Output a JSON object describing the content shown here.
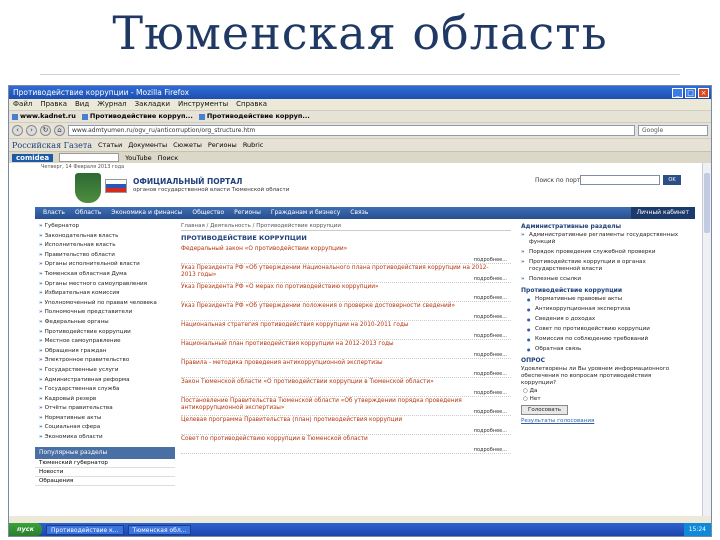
{
  "slide": {
    "title": "Тюменская область"
  },
  "browser": {
    "window_title": "Противодействие коррупции - Mozilla Firefox",
    "menu": [
      "Файл",
      "Правка",
      "Вид",
      "Журнал",
      "Закладки",
      "Инструменты",
      "Справка"
    ],
    "bookmarks": [
      "www.kadnet.ru",
      "Противодействие корруп...",
      "Противодействие корруп..."
    ],
    "url": "www.admtyumen.ru/ogv_ru/anticorruption/org_structure.htm",
    "search_placeholder": "Google",
    "toolbar2": [
      "Российская Газета",
      "Статьи",
      "Документы",
      "Сюжеты",
      "Регионы",
      "Rubric"
    ],
    "toolbar3_logo": "comidea",
    "toolbar3_field": "YouTube",
    "toolbar3_btn": "Поиск"
  },
  "site": {
    "top_line": "Четверг, 14 Февраля 2013 года",
    "name": "ОФИЦИАЛЬНЫЙ ПОРТАЛ",
    "subtitle": "органов государственной власти Тюменской области",
    "search_label": "Поиск по порталу",
    "search_btn": "OK",
    "nav": [
      "Власть",
      "Область",
      "Экономика и финансы",
      "Общество",
      "Регионы",
      "Гражданам и бизнесу",
      "Связь"
    ],
    "cabinet": "Личный кабинет",
    "breadcrumb": "Главная / Деятельность / Противодействие коррупции",
    "section_title": "ПРОТИВОДЕЙСТВИЕ КОРРУПЦИИ",
    "left_links": [
      "Губернатор",
      "Законодательная власть",
      "Исполнительная власть",
      "Правительство области",
      "Органы исполнительной власти",
      "Тюменская областная Дума",
      "Органы местного самоуправления",
      "Избирательная комиссия",
      "Уполномоченный по правам человека",
      "Полномочные представители",
      "Федеральные органы",
      "Противодействие коррупции",
      "Местное самоуправление",
      "Обращения граждан",
      "Электронное правительство",
      "Государственные услуги",
      "Административная реформа",
      "Государственная служба",
      "Кадровый резерв",
      "Отчёты правительства",
      "Нормативные акты",
      "Социальная сфера",
      "Экономика области"
    ],
    "left_box_title": "Популярные разделы",
    "left_box_items": [
      "Тюменский губернатор",
      "Новости",
      "Обращения"
    ],
    "news": [
      {
        "title": "Федеральный закон «О противодействии коррупции»",
        "more": "подробнее..."
      },
      {
        "title": "Указ Президента РФ «Об утверждении Национального плана противодействия коррупции на 2012-2013 годы»",
        "more": "подробнее..."
      },
      {
        "title": "Указ Президента РФ «О мерах по противодействию коррупции»",
        "more": "подробнее..."
      },
      {
        "title": "Указ Президента РФ «Об утверждении положения о проверке достоверности сведений»",
        "more": "подробнее..."
      },
      {
        "title": "Национальная стратегия противодействия коррупции на 2010-2011 годы",
        "more": "подробнее..."
      },
      {
        "title": "Национальный план противодействия коррупции на 2012-2013 годы",
        "more": "подробнее..."
      },
      {
        "title": "Правила - методика проведения антикоррупционной экспертизы",
        "more": "подробнее..."
      },
      {
        "title": "Закон Тюменской области «О противодействии коррупции в Тюменской области»",
        "more": "подробнее..."
      },
      {
        "title": "Постановление Правительства Тюменской области «Об утверждении порядка проведения антикоррупционной экспертизы»",
        "more": "подробнее..."
      },
      {
        "title": "Целевая программа Правительства (план) противодействия коррупции",
        "more": "подробнее..."
      },
      {
        "title": "Совет по противодействию коррупции в Тюменской области",
        "more": "подробнее..."
      }
    ],
    "right_head1": "Административные разделы",
    "right_items": [
      "Административные регламенты государственных функций",
      "Порядок проведения служебной проверки",
      "Противодействие коррупции в органах государственной власти",
      "Полезные ссылки"
    ],
    "right_head2": "Противодействие коррупции",
    "right_sub": [
      "Нормативные правовые акты",
      "Антикоррупционная экспертиза",
      "Сведения о доходах",
      "Совет по противодействию коррупции",
      "Комиссия по соблюдению требований",
      "Обратная связь"
    ],
    "poll_head": "ОПРОС",
    "poll_question": "Удовлетворены ли Вы уровнем информационного обеспечения по вопросам противодействия коррупции?",
    "poll_options": [
      "Да",
      "Нет"
    ],
    "poll_btn": "Голосовать",
    "poll_results": "Результаты голосования"
  },
  "taskbar": {
    "start": "пуск",
    "tasks": [
      "Противодействие к...",
      "Тюменская обл..."
    ],
    "clock": "15:24"
  }
}
